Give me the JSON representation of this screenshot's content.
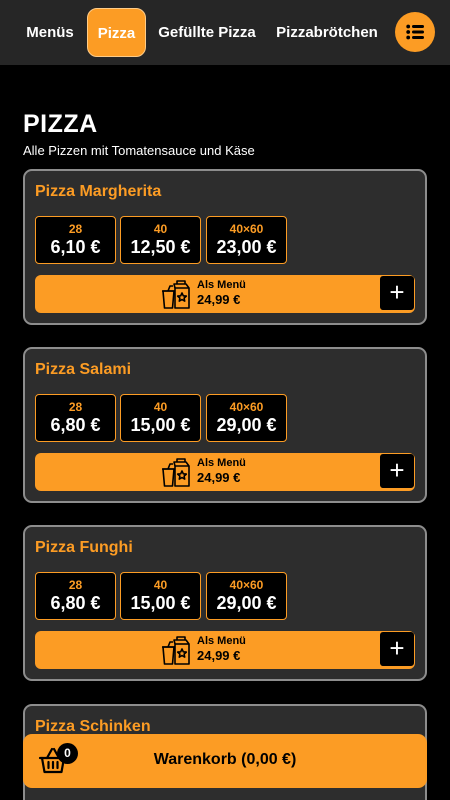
{
  "nav": {
    "tabs": [
      {
        "label": "Menüs",
        "active": false
      },
      {
        "label": "Pizza",
        "active": true
      },
      {
        "label": "Gefüllte Pizza",
        "active": false
      },
      {
        "label": "Pizzabrötchen",
        "active": false
      }
    ],
    "menu_icon": "list-icon"
  },
  "section": {
    "title": "PIZZA",
    "subtitle": "Alle Pizzen mit Tomatensauce und Käse"
  },
  "products": [
    {
      "name": "Pizza Margherita",
      "prices": [
        {
          "size": "28",
          "price": "6,10 €"
        },
        {
          "size": "40",
          "price": "12,50 €"
        },
        {
          "size": "40×60",
          "price": "23,00 €"
        }
      ],
      "menu_label": "Als Menü",
      "menu_price": "24,99 €"
    },
    {
      "name": "Pizza Salami",
      "prices": [
        {
          "size": "28",
          "price": "6,80 €"
        },
        {
          "size": "40",
          "price": "15,00 €"
        },
        {
          "size": "40×60",
          "price": "29,00 €"
        }
      ],
      "menu_label": "Als Menü",
      "menu_price": "24,99 €"
    },
    {
      "name": "Pizza Funghi",
      "prices": [
        {
          "size": "28",
          "price": "6,80 €"
        },
        {
          "size": "40",
          "price": "15,00 €"
        },
        {
          "size": "40×60",
          "price": "29,00 €"
        }
      ],
      "menu_label": "Als Menü",
      "menu_price": "24,99 €"
    },
    {
      "name": "Pizza Schinken"
    }
  ],
  "cart": {
    "count": "0",
    "label": "Warenkorb (0,00 €)",
    "icon": "basket-icon"
  },
  "colors": {
    "accent": "#fc9c24",
    "background": "#000000",
    "card": "#2d2d2d",
    "nav": "#262626"
  }
}
